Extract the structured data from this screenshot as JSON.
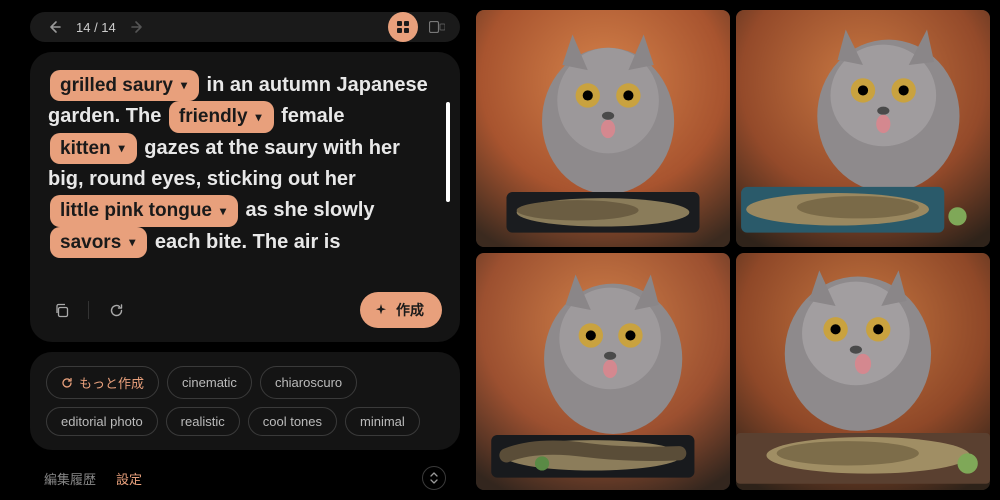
{
  "nav": {
    "counter": "14 / 14"
  },
  "prompt": {
    "pills": {
      "p1": "grilled saury",
      "p2": "friendly",
      "p3": "kitten",
      "p4": "little pink tongue",
      "p5": "savors"
    },
    "frags": {
      "f1": " in an autumn Japanese garden. The ",
      "f2": " female ",
      "f3": " gazes at the saury with her big, round eyes, sticking out her ",
      "f4": " as she slowly ",
      "f5": " each bite. The air is"
    }
  },
  "actions": {
    "create_label": "作成"
  },
  "chips": {
    "more": "もっと作成",
    "c1": "cinematic",
    "c2": "chiaroscuro",
    "c3": "editorial photo",
    "c4": "realistic",
    "c5": "cool tones",
    "c6": "minimal"
  },
  "tabs": {
    "history": "編集履歴",
    "settings": "設定"
  }
}
